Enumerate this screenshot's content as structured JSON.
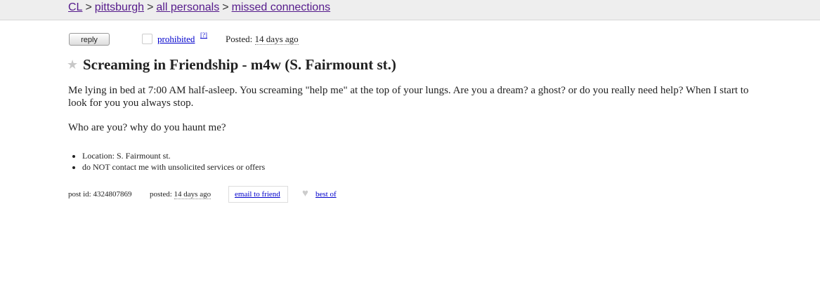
{
  "breadcrumbs": {
    "items": [
      "CL",
      "pittsburgh",
      "all personals",
      "missed connections"
    ],
    "separator": ">"
  },
  "actions": {
    "reply_label": "reply",
    "flag_label": "prohibited",
    "flag_help": "[?]",
    "posted_label": "Posted:",
    "posted_date": "14 days ago"
  },
  "post": {
    "star_icon": "star-icon",
    "title": "Screaming in Friendship - m4w (S. Fairmount st.)",
    "paragraphs": [
      "Me lying in bed at 7:00 AM half-asleep. You screaming \"help me\" at the top of your lungs. Are you a dream? a ghost? or do you really need help? When I start to look for you you always stop.",
      "Who are you? why do you haunt me?"
    ],
    "attributes": [
      "Location: S. Fairmount st.",
      "do NOT contact me with unsolicited services or offers"
    ]
  },
  "footer": {
    "post_id": "post id: 4324807869",
    "posted_label": "posted:",
    "posted_date": "14 days ago",
    "email_label": "email to friend",
    "heart_icon": "heart-icon",
    "best_of_label": "best of"
  },
  "colors": {
    "visited_link": "#551a8b",
    "link": "#0000cc",
    "topbar_bg": "#eeeeee"
  }
}
